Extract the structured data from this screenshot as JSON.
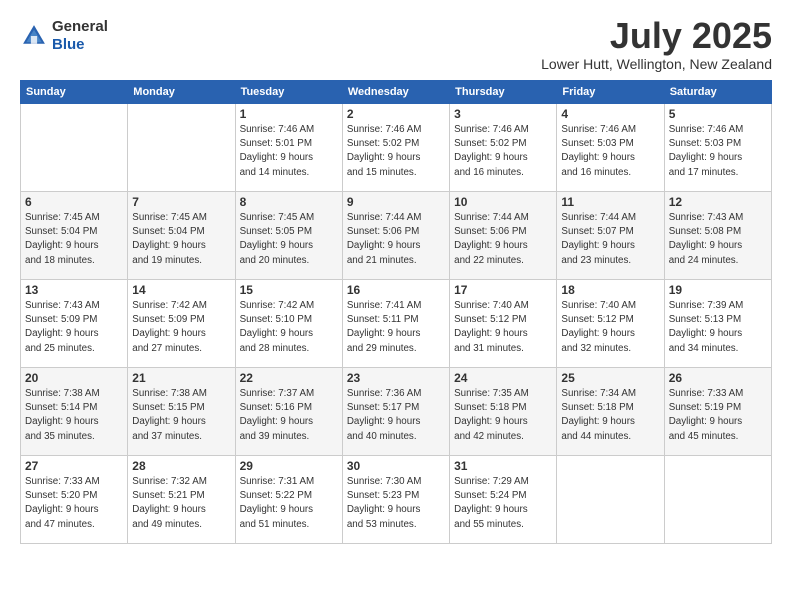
{
  "logo": {
    "line1": "General",
    "line2": "Blue"
  },
  "title": "July 2025",
  "location": "Lower Hutt, Wellington, New Zealand",
  "weekdays": [
    "Sunday",
    "Monday",
    "Tuesday",
    "Wednesday",
    "Thursday",
    "Friday",
    "Saturday"
  ],
  "weeks": [
    [
      {
        "day": "",
        "info": ""
      },
      {
        "day": "",
        "info": ""
      },
      {
        "day": "1",
        "info": "Sunrise: 7:46 AM\nSunset: 5:01 PM\nDaylight: 9 hours\nand 14 minutes."
      },
      {
        "day": "2",
        "info": "Sunrise: 7:46 AM\nSunset: 5:02 PM\nDaylight: 9 hours\nand 15 minutes."
      },
      {
        "day": "3",
        "info": "Sunrise: 7:46 AM\nSunset: 5:02 PM\nDaylight: 9 hours\nand 16 minutes."
      },
      {
        "day": "4",
        "info": "Sunrise: 7:46 AM\nSunset: 5:03 PM\nDaylight: 9 hours\nand 16 minutes."
      },
      {
        "day": "5",
        "info": "Sunrise: 7:46 AM\nSunset: 5:03 PM\nDaylight: 9 hours\nand 17 minutes."
      }
    ],
    [
      {
        "day": "6",
        "info": "Sunrise: 7:45 AM\nSunset: 5:04 PM\nDaylight: 9 hours\nand 18 minutes."
      },
      {
        "day": "7",
        "info": "Sunrise: 7:45 AM\nSunset: 5:04 PM\nDaylight: 9 hours\nand 19 minutes."
      },
      {
        "day": "8",
        "info": "Sunrise: 7:45 AM\nSunset: 5:05 PM\nDaylight: 9 hours\nand 20 minutes."
      },
      {
        "day": "9",
        "info": "Sunrise: 7:44 AM\nSunset: 5:06 PM\nDaylight: 9 hours\nand 21 minutes."
      },
      {
        "day": "10",
        "info": "Sunrise: 7:44 AM\nSunset: 5:06 PM\nDaylight: 9 hours\nand 22 minutes."
      },
      {
        "day": "11",
        "info": "Sunrise: 7:44 AM\nSunset: 5:07 PM\nDaylight: 9 hours\nand 23 minutes."
      },
      {
        "day": "12",
        "info": "Sunrise: 7:43 AM\nSunset: 5:08 PM\nDaylight: 9 hours\nand 24 minutes."
      }
    ],
    [
      {
        "day": "13",
        "info": "Sunrise: 7:43 AM\nSunset: 5:09 PM\nDaylight: 9 hours\nand 25 minutes."
      },
      {
        "day": "14",
        "info": "Sunrise: 7:42 AM\nSunset: 5:09 PM\nDaylight: 9 hours\nand 27 minutes."
      },
      {
        "day": "15",
        "info": "Sunrise: 7:42 AM\nSunset: 5:10 PM\nDaylight: 9 hours\nand 28 minutes."
      },
      {
        "day": "16",
        "info": "Sunrise: 7:41 AM\nSunset: 5:11 PM\nDaylight: 9 hours\nand 29 minutes."
      },
      {
        "day": "17",
        "info": "Sunrise: 7:40 AM\nSunset: 5:12 PM\nDaylight: 9 hours\nand 31 minutes."
      },
      {
        "day": "18",
        "info": "Sunrise: 7:40 AM\nSunset: 5:12 PM\nDaylight: 9 hours\nand 32 minutes."
      },
      {
        "day": "19",
        "info": "Sunrise: 7:39 AM\nSunset: 5:13 PM\nDaylight: 9 hours\nand 34 minutes."
      }
    ],
    [
      {
        "day": "20",
        "info": "Sunrise: 7:38 AM\nSunset: 5:14 PM\nDaylight: 9 hours\nand 35 minutes."
      },
      {
        "day": "21",
        "info": "Sunrise: 7:38 AM\nSunset: 5:15 PM\nDaylight: 9 hours\nand 37 minutes."
      },
      {
        "day": "22",
        "info": "Sunrise: 7:37 AM\nSunset: 5:16 PM\nDaylight: 9 hours\nand 39 minutes."
      },
      {
        "day": "23",
        "info": "Sunrise: 7:36 AM\nSunset: 5:17 PM\nDaylight: 9 hours\nand 40 minutes."
      },
      {
        "day": "24",
        "info": "Sunrise: 7:35 AM\nSunset: 5:18 PM\nDaylight: 9 hours\nand 42 minutes."
      },
      {
        "day": "25",
        "info": "Sunrise: 7:34 AM\nSunset: 5:18 PM\nDaylight: 9 hours\nand 44 minutes."
      },
      {
        "day": "26",
        "info": "Sunrise: 7:33 AM\nSunset: 5:19 PM\nDaylight: 9 hours\nand 45 minutes."
      }
    ],
    [
      {
        "day": "27",
        "info": "Sunrise: 7:33 AM\nSunset: 5:20 PM\nDaylight: 9 hours\nand 47 minutes."
      },
      {
        "day": "28",
        "info": "Sunrise: 7:32 AM\nSunset: 5:21 PM\nDaylight: 9 hours\nand 49 minutes."
      },
      {
        "day": "29",
        "info": "Sunrise: 7:31 AM\nSunset: 5:22 PM\nDaylight: 9 hours\nand 51 minutes."
      },
      {
        "day": "30",
        "info": "Sunrise: 7:30 AM\nSunset: 5:23 PM\nDaylight: 9 hours\nand 53 minutes."
      },
      {
        "day": "31",
        "info": "Sunrise: 7:29 AM\nSunset: 5:24 PM\nDaylight: 9 hours\nand 55 minutes."
      },
      {
        "day": "",
        "info": ""
      },
      {
        "day": "",
        "info": ""
      }
    ]
  ]
}
